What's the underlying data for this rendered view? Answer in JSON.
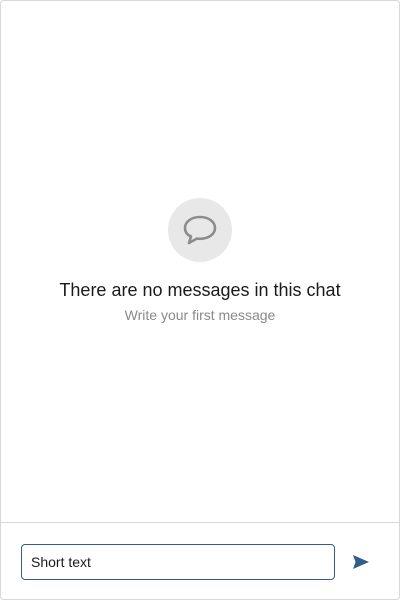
{
  "empty_state": {
    "icon": "chat-bubble-icon",
    "title": "There are no messages in this chat",
    "subtitle": "Write your first message"
  },
  "composer": {
    "input_value": "Short text",
    "send_icon": "send-icon"
  },
  "colors": {
    "accent": "#2f5f8a",
    "icon_background": "#e8e8e8",
    "icon_stroke": "#8c8c8c",
    "border": "#d9d9d9"
  }
}
